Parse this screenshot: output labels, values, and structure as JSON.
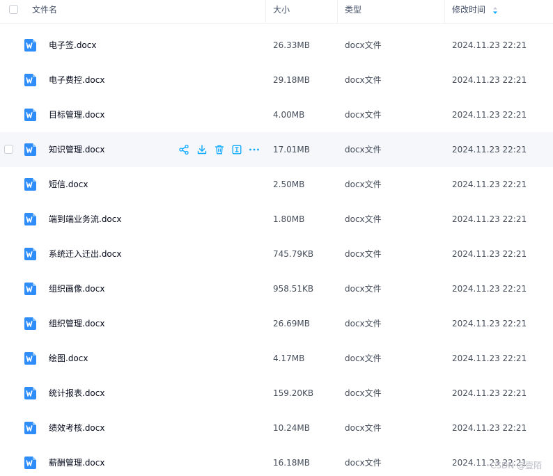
{
  "header": {
    "name": "文件名",
    "size": "大小",
    "type": "类型",
    "mtime": "修改时间"
  },
  "colors": {
    "accent": "#06a7ff",
    "word_icon": "#2f8dfa",
    "hover_row": "#f5f7fb"
  },
  "row_actions": [
    {
      "icon": "share-icon"
    },
    {
      "icon": "download-icon"
    },
    {
      "icon": "delete-icon"
    },
    {
      "icon": "rename-icon"
    },
    {
      "icon": "more-icon"
    }
  ],
  "files": [
    {
      "name": "电子签.docx",
      "size": "26.33MB",
      "type": "docx文件",
      "mtime": "2024.11.23 22:21"
    },
    {
      "name": "电子费控.docx",
      "size": "29.18MB",
      "type": "docx文件",
      "mtime": "2024.11.23 22:21"
    },
    {
      "name": "目标管理.docx",
      "size": "4.00MB",
      "type": "docx文件",
      "mtime": "2024.11.23 22:21"
    },
    {
      "name": "知识管理.docx",
      "size": "17.01MB",
      "type": "docx文件",
      "mtime": "2024.11.23 22:21"
    },
    {
      "name": "短信.docx",
      "size": "2.50MB",
      "type": "docx文件",
      "mtime": "2024.11.23 22:21"
    },
    {
      "name": "端到端业务流.docx",
      "size": "1.80MB",
      "type": "docx文件",
      "mtime": "2024.11.23 22:21"
    },
    {
      "name": "系统迁入迁出.docx",
      "size": "745.79KB",
      "type": "docx文件",
      "mtime": "2024.11.23 22:21"
    },
    {
      "name": "组织画像.docx",
      "size": "958.51KB",
      "type": "docx文件",
      "mtime": "2024.11.23 22:21"
    },
    {
      "name": "组织管理.docx",
      "size": "26.69MB",
      "type": "docx文件",
      "mtime": "2024.11.23 22:21"
    },
    {
      "name": "绘图.docx",
      "size": "4.17MB",
      "type": "docx文件",
      "mtime": "2024.11.23 22:21"
    },
    {
      "name": "统计报表.docx",
      "size": "159.20KB",
      "type": "docx文件",
      "mtime": "2024.11.23 22:21"
    },
    {
      "name": "绩效考核.docx",
      "size": "10.24MB",
      "type": "docx文件",
      "mtime": "2024.11.23 22:21"
    },
    {
      "name": "薪酬管理.docx",
      "size": "16.18MB",
      "type": "docx文件",
      "mtime": "2024.11.23 22:21"
    }
  ],
  "watermark": "CSDN @壹陌"
}
